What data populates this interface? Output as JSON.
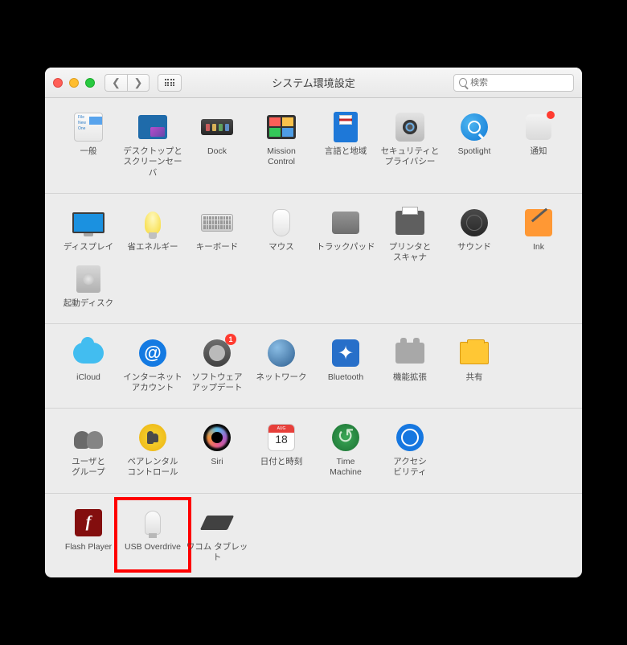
{
  "window": {
    "title": "システム環境設定"
  },
  "search": {
    "placeholder": "検索"
  },
  "calendar": {
    "month": "AUG",
    "day": "18"
  },
  "sections": [
    {
      "id": "row1",
      "items": [
        {
          "key": "general",
          "label": "一般"
        },
        {
          "key": "desktop",
          "label": "デスクトップと\nスクリーンセーバ"
        },
        {
          "key": "dock",
          "label": "Dock"
        },
        {
          "key": "mission",
          "label": "Mission\nControl"
        },
        {
          "key": "lang",
          "label": "言語と地域"
        },
        {
          "key": "security",
          "label": "セキュリティと\nプライバシー"
        },
        {
          "key": "spotlight",
          "label": "Spotlight"
        },
        {
          "key": "notif",
          "label": "通知",
          "dot": true
        }
      ]
    },
    {
      "id": "row2",
      "items": [
        {
          "key": "display",
          "label": "ディスプレイ"
        },
        {
          "key": "energy",
          "label": "省エネルギー"
        },
        {
          "key": "keyboard",
          "label": "キーボード"
        },
        {
          "key": "mouse",
          "label": "マウス"
        },
        {
          "key": "trackpad",
          "label": "トラックパッド"
        },
        {
          "key": "printer",
          "label": "プリンタと\nスキャナ"
        },
        {
          "key": "sound",
          "label": "サウンド"
        },
        {
          "key": "ink",
          "label": "Ink"
        },
        {
          "key": "disk",
          "label": "起動ディスク"
        }
      ]
    },
    {
      "id": "row3",
      "items": [
        {
          "key": "icloud",
          "label": "iCloud"
        },
        {
          "key": "accounts",
          "label": "インターネット\nアカウント"
        },
        {
          "key": "update",
          "label": "ソフトウェア\nアップデート",
          "badge": "1"
        },
        {
          "key": "network",
          "label": "ネットワーク"
        },
        {
          "key": "bt",
          "label": "Bluetooth"
        },
        {
          "key": "ext",
          "label": "機能拡張"
        },
        {
          "key": "share",
          "label": "共有"
        }
      ]
    },
    {
      "id": "row4",
      "items": [
        {
          "key": "users",
          "label": "ユーザと\nグループ"
        },
        {
          "key": "parent",
          "label": "ペアレンタル\nコントロール"
        },
        {
          "key": "siri",
          "label": "Siri"
        },
        {
          "key": "date",
          "label": "日付と時刻"
        },
        {
          "key": "tm",
          "label": "Time\nMachine"
        },
        {
          "key": "access",
          "label": "アクセシ\nビリティ"
        }
      ]
    },
    {
      "id": "row5",
      "items": [
        {
          "key": "flash",
          "label": "Flash Player"
        },
        {
          "key": "usb",
          "label": "USB Overdrive",
          "highlight": true
        },
        {
          "key": "wacom",
          "label": "ワコム タブレット"
        }
      ]
    }
  ]
}
